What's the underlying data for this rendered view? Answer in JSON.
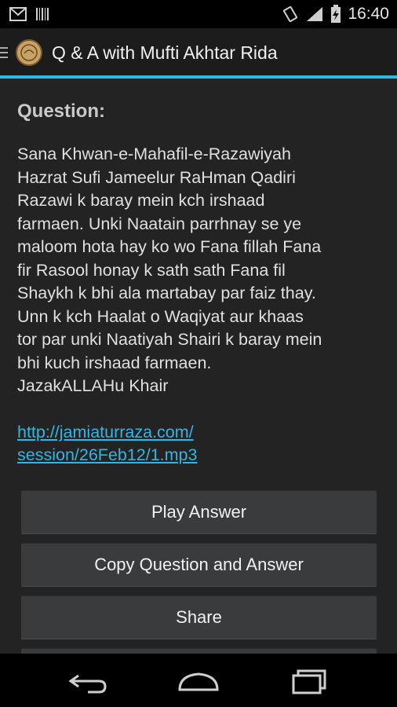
{
  "status_bar": {
    "time": "16:40",
    "icons": [
      "gmail-icon",
      "barcode-icon",
      "vibrate-icon",
      "signal-icon",
      "battery-charging-icon"
    ]
  },
  "action_bar": {
    "title": "Q & A with Mufti Akhtar Rida",
    "accent_color": "#33b5e5"
  },
  "content": {
    "heading": "Question:",
    "question": "Sana Khwan-e-Mahafil-e-Razawiyah\nHazrat Sufi Jameelur RaHman Qadiri\nRazawi k baray mein kch irshaad\nfarmaen. Unki Naatain parrhnay se ye\nmaloom hota hay ko wo Fana fillah Fana\nfir Rasool honay k sath sath Fana fil\nShaykh k bhi ala martabay par faiz thay.\nUnn k kch Haalat o Waqiyat aur khaas\ntor par unki Naatiyah Shairi k baray mein\nbhi kuch irshaad farmaen.\nJazakALLAHu Khair",
    "link": "http://jamiaturraza.com/\nsession/26Feb12/1.mp3"
  },
  "buttons": {
    "play": "Play Answer",
    "copy": "Copy Question and Answer",
    "share": "Share"
  },
  "nav_bar": {
    "icons": [
      "back-icon",
      "home-icon",
      "recents-icon"
    ]
  }
}
